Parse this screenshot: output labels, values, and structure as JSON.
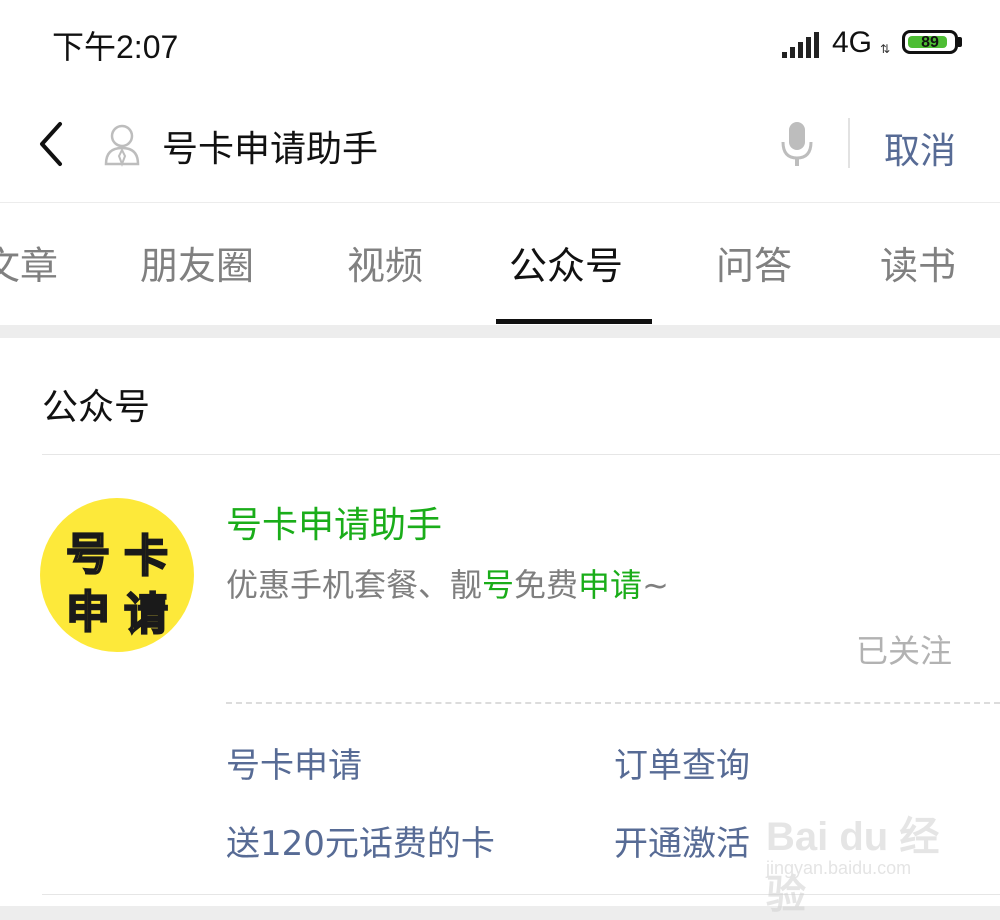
{
  "status_bar": {
    "time": "下午2:07",
    "network": "4G",
    "battery": "89",
    "battery_level": 0.89,
    "battery_color": "#4dbd33"
  },
  "search_bar": {
    "query": "号卡申请助手",
    "cancel_label": "取消",
    "icons": [
      "back-icon",
      "user-icon",
      "microphone-icon"
    ]
  },
  "tabs": [
    {
      "label": "文章",
      "active": false
    },
    {
      "label": "朋友圈",
      "active": false
    },
    {
      "label": "视频",
      "active": false
    },
    {
      "label": "公众号",
      "active": true
    },
    {
      "label": "问答",
      "active": false
    },
    {
      "label": "读书",
      "active": false
    }
  ],
  "results": {
    "section_title": "公众号",
    "account": {
      "name": "号卡申请助手",
      "avatar_text": [
        "号",
        "卡",
        "申",
        "请"
      ],
      "description": [
        {
          "text": "优惠手机套餐、靓",
          "highlight": false
        },
        {
          "text": "号",
          "highlight": true
        },
        {
          "text": "免费",
          "highlight": false
        },
        {
          "text": "申请",
          "highlight": true
        },
        {
          "text": "~",
          "highlight": false
        }
      ],
      "status": "已关注",
      "menu": [
        "号卡申请",
        "订单查询",
        "送120元话费的卡",
        "开通激活"
      ]
    }
  },
  "watermark": {
    "logo": "Bai du 经验",
    "url": "jingyan.baidu.com"
  },
  "colors": {
    "brand_green": "#1aad19",
    "link_blue": "#576b95",
    "avatar_yellow": "#fde93a"
  }
}
